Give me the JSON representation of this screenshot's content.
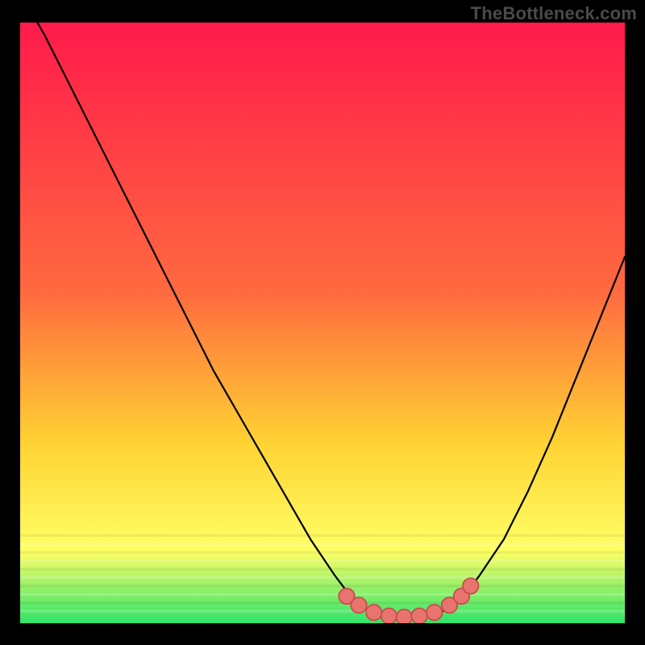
{
  "watermark": "TheBottleneck.com",
  "colors": {
    "bg": "#000000",
    "curve": "#000000",
    "marker_fill": "#e9736f",
    "marker_stroke": "#c94f4b",
    "grad_top": "#ff1a4b",
    "grad_mid1": "#ff6a3f",
    "grad_mid2": "#ffd233",
    "grad_mid3": "#ffff66",
    "grad_bottom": "#2fe36b"
  },
  "chart_data": {
    "type": "line",
    "title": "",
    "xlabel": "",
    "ylabel": "",
    "xlim": [
      0,
      100
    ],
    "ylim": [
      0,
      100
    ],
    "series": [
      {
        "name": "bottleneck-curve",
        "x": [
          0,
          4,
          8,
          12,
          16,
          20,
          24,
          28,
          32,
          36,
          40,
          44,
          48,
          52,
          55,
          58,
          61,
          64,
          67,
          70,
          73,
          76,
          80,
          84,
          88,
          92,
          96,
          100
        ],
        "y": [
          105,
          98,
          90,
          82,
          74,
          66,
          58,
          50,
          42,
          35,
          28,
          21,
          14,
          8,
          4,
          2,
          1,
          1,
          1,
          2,
          4,
          8,
          14,
          22,
          31,
          41,
          51,
          61
        ]
      }
    ],
    "markers": {
      "name": "valley-markers",
      "points": [
        {
          "x": 54,
          "y": 4.5
        },
        {
          "x": 56,
          "y": 3.0
        },
        {
          "x": 58.5,
          "y": 1.8
        },
        {
          "x": 61,
          "y": 1.2
        },
        {
          "x": 63.5,
          "y": 1.0
        },
        {
          "x": 66,
          "y": 1.2
        },
        {
          "x": 68.5,
          "y": 1.8
        },
        {
          "x": 71,
          "y": 3.0
        },
        {
          "x": 73,
          "y": 4.5
        },
        {
          "x": 74.5,
          "y": 6.2
        }
      ],
      "radius": 1.3
    },
    "gradient_bands": [
      {
        "y": 100,
        "color_key": "grad_top"
      },
      {
        "y": 55,
        "color_key": "grad_mid1"
      },
      {
        "y": 30,
        "color_key": "grad_mid2"
      },
      {
        "y": 12,
        "color_key": "grad_mid3"
      },
      {
        "y": 0,
        "color_key": "grad_bottom"
      }
    ]
  }
}
